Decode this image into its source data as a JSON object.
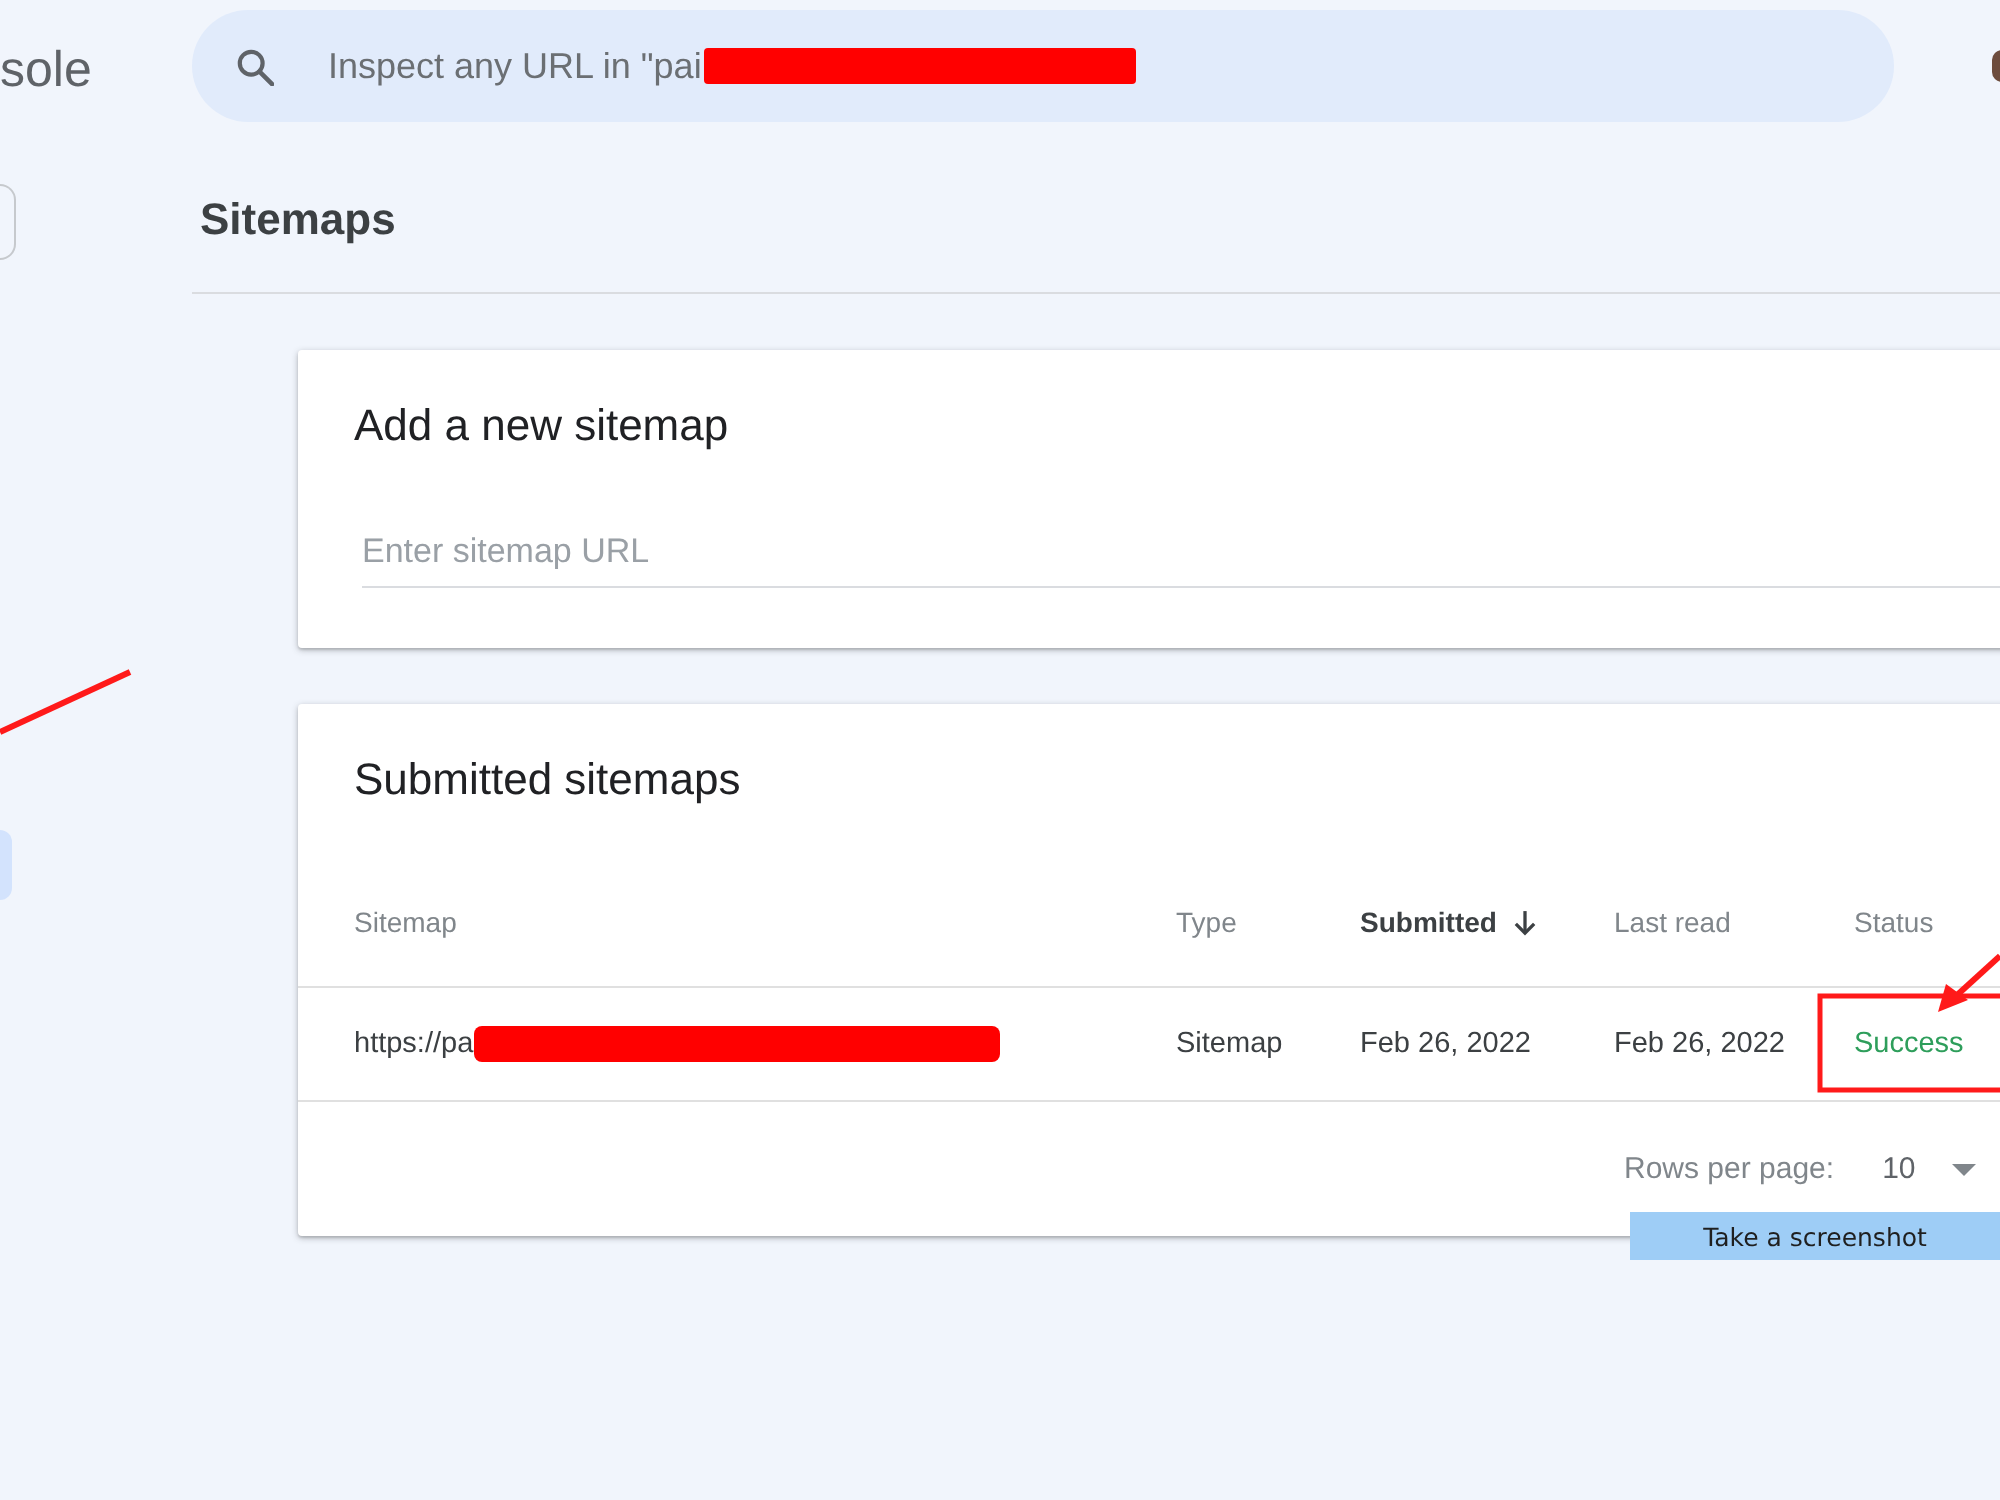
{
  "header": {
    "product_name": "sole",
    "search": {
      "placeholder": "Inspect any URL in \"pai",
      "redacted": true
    }
  },
  "page_title": "Sitemaps",
  "add_sitemap": {
    "title": "Add a new sitemap",
    "input": {
      "placeholder": "Enter sitemap URL"
    }
  },
  "submitted_sitemaps": {
    "title": "Submitted sitemaps",
    "columns": [
      {
        "label": "Sitemap",
        "sorted": false
      },
      {
        "label": "Type",
        "sorted": false
      },
      {
        "label": "Submitted",
        "sorted": true
      },
      {
        "label": "Last read",
        "sorted": false
      },
      {
        "label": "Status",
        "sorted": false
      }
    ],
    "rows": [
      {
        "sitemap": {
          "text": "https://pa",
          "redacted": true
        },
        "type": "Sitemap",
        "submitted": "Feb 26, 2022",
        "last_read": "Feb 26, 2022",
        "status": {
          "text": "Success",
          "kind": "success"
        }
      }
    ],
    "pagination": {
      "label": "Rows per page:",
      "value": "10"
    }
  },
  "tooltip": {
    "text": "Take a screenshot"
  }
}
